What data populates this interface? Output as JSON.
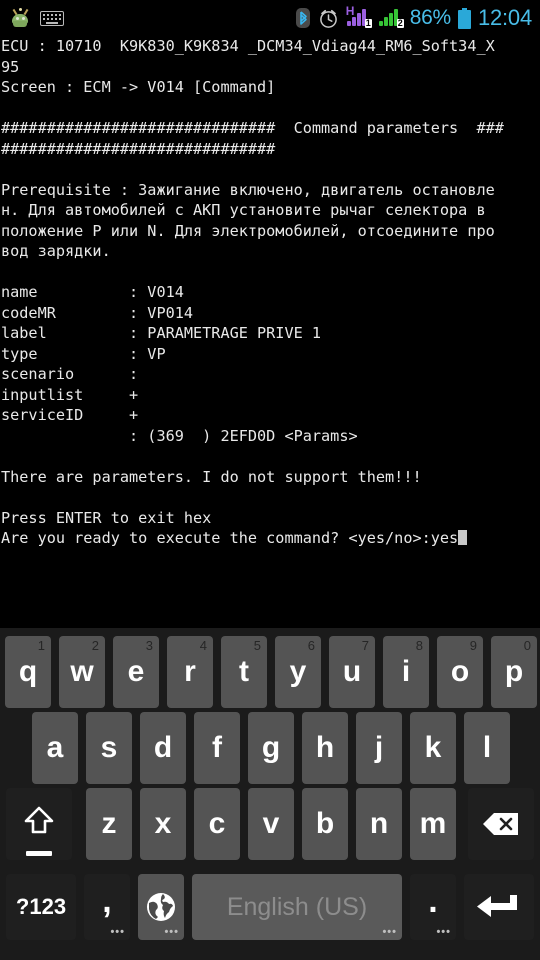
{
  "statusbar": {
    "icons": [
      "android-mascot-icon",
      "keyboard-icon",
      "bluetooth-icon",
      "alarm-icon"
    ],
    "signal1": {
      "tech": "H",
      "sim": "1",
      "color": "#9b5fe0",
      "bars": 4
    },
    "signal2": {
      "tech": "",
      "sim": "2",
      "color": "#36c436",
      "bars": 4
    },
    "battery_percent": "86%",
    "clock": "12:04",
    "accent": "#49bde8"
  },
  "terminal": {
    "lines": [
      "ECU : 10710  K9K830_K9K834 _DCM34_Vdiag44_RM6_Soft34_X",
      "95",
      "Screen : ECM -> V014 [Command]",
      "",
      "##############################  Command parameters  ###",
      "##############################",
      "",
      "Prerequisite : Зажигание включено, двигатель остановле",
      "н. Для автомобилей с АКП установите рычаг селектора в",
      "положение P или N. Для электромобилей, отсоедините про",
      "вод зарядки.",
      "",
      "name          : V014",
      "codeMR        : VP014",
      "label         : PARAMETRAGE PRIVE 1",
      "type          : VP",
      "scenario      :",
      "inputlist     +",
      "serviceID     +",
      "              : (369  ) 2EFD0D <Params>",
      "",
      "There are parameters. I do not support them!!!",
      "",
      "Press ENTER to exit hex"
    ],
    "prompt_line": "Are you ready to execute the command? <yes/no>:yes",
    "cursor_visible": true,
    "text_color": "#e9e9e9",
    "background": "#000000"
  },
  "keyboard": {
    "language": "English (US)",
    "row1": [
      {
        "label": "q",
        "hint": "1"
      },
      {
        "label": "w",
        "hint": "2"
      },
      {
        "label": "e",
        "hint": "3"
      },
      {
        "label": "r",
        "hint": "4"
      },
      {
        "label": "t",
        "hint": "5"
      },
      {
        "label": "y",
        "hint": "6"
      },
      {
        "label": "u",
        "hint": "7"
      },
      {
        "label": "i",
        "hint": "8"
      },
      {
        "label": "o",
        "hint": "9"
      },
      {
        "label": "p",
        "hint": "0"
      }
    ],
    "row2": [
      {
        "label": "a"
      },
      {
        "label": "s"
      },
      {
        "label": "d"
      },
      {
        "label": "f"
      },
      {
        "label": "g"
      },
      {
        "label": "h"
      },
      {
        "label": "j"
      },
      {
        "label": "k"
      },
      {
        "label": "l"
      }
    ],
    "row3": [
      {
        "label": "z"
      },
      {
        "label": "x"
      },
      {
        "label": "c"
      },
      {
        "label": "v"
      },
      {
        "label": "b"
      },
      {
        "label": "n"
      },
      {
        "label": "m"
      }
    ],
    "shift_key": "shift-key",
    "backspace_key": "backspace-key",
    "symbols_key": "?123",
    "comma_key": ",",
    "globe_key": "globe-icon",
    "period_key": ".",
    "enter_key": "enter-key",
    "key_color": "#545454",
    "function_key_color": "#1f1f1f",
    "space_color": "#5a5a5a"
  }
}
